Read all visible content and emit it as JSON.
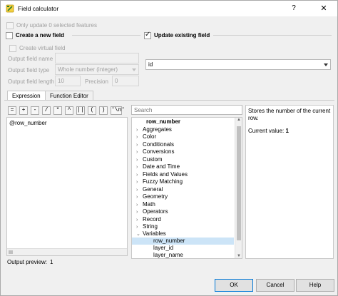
{
  "window": {
    "title": "Field calculator",
    "help_glyph": "?",
    "close_glyph": "✕"
  },
  "only_selected": {
    "label": "Only update 0 selected features",
    "checked": false,
    "enabled": false
  },
  "create_field": {
    "label": "Create a new field",
    "checked": false,
    "virtual_label": "Create virtual field",
    "name_label": "Output field name",
    "name_value": "",
    "type_label": "Output field type",
    "type_value": "Whole number (integer)",
    "length_label": "Output field length",
    "length_value": "10",
    "precision_label": "Precision",
    "precision_value": "0"
  },
  "update_field": {
    "label": "Update existing field",
    "checked": true,
    "selected_field": "id"
  },
  "tabs": [
    {
      "label": "Expression",
      "active": true
    },
    {
      "label": "Function Editor",
      "active": false
    }
  ],
  "operators": [
    "=",
    "+",
    "-",
    "/",
    "*",
    "^",
    "||",
    "(",
    ")",
    "'\\n'"
  ],
  "expression": {
    "text": "@row_number"
  },
  "search": {
    "placeholder": "Search"
  },
  "tree": {
    "header": "row_number",
    "items": [
      {
        "label": "Aggregates",
        "arrow": "›"
      },
      {
        "label": "Color",
        "arrow": "›"
      },
      {
        "label": "Conditionals",
        "arrow": "›"
      },
      {
        "label": "Conversions",
        "arrow": "›"
      },
      {
        "label": "Custom",
        "arrow": "›"
      },
      {
        "label": "Date and Time",
        "arrow": "›"
      },
      {
        "label": "Fields and Values",
        "arrow": "›"
      },
      {
        "label": "Fuzzy Matching",
        "arrow": "›"
      },
      {
        "label": "General",
        "arrow": "›"
      },
      {
        "label": "Geometry",
        "arrow": "›"
      },
      {
        "label": "Math",
        "arrow": "›"
      },
      {
        "label": "Operators",
        "arrow": "›"
      },
      {
        "label": "Record",
        "arrow": "›"
      },
      {
        "label": "String",
        "arrow": "›"
      },
      {
        "label": "Variables",
        "arrow": "⌄"
      }
    ],
    "children": [
      "row_number",
      "layer_id",
      "layer_name"
    ]
  },
  "help": {
    "description": "Stores the number of the current row.",
    "current_label": "Current value:",
    "current_value": "1"
  },
  "preview": {
    "label": "Output preview:",
    "value": "1"
  },
  "buttons": {
    "ok": "OK",
    "cancel": "Cancel",
    "help": "Help"
  }
}
